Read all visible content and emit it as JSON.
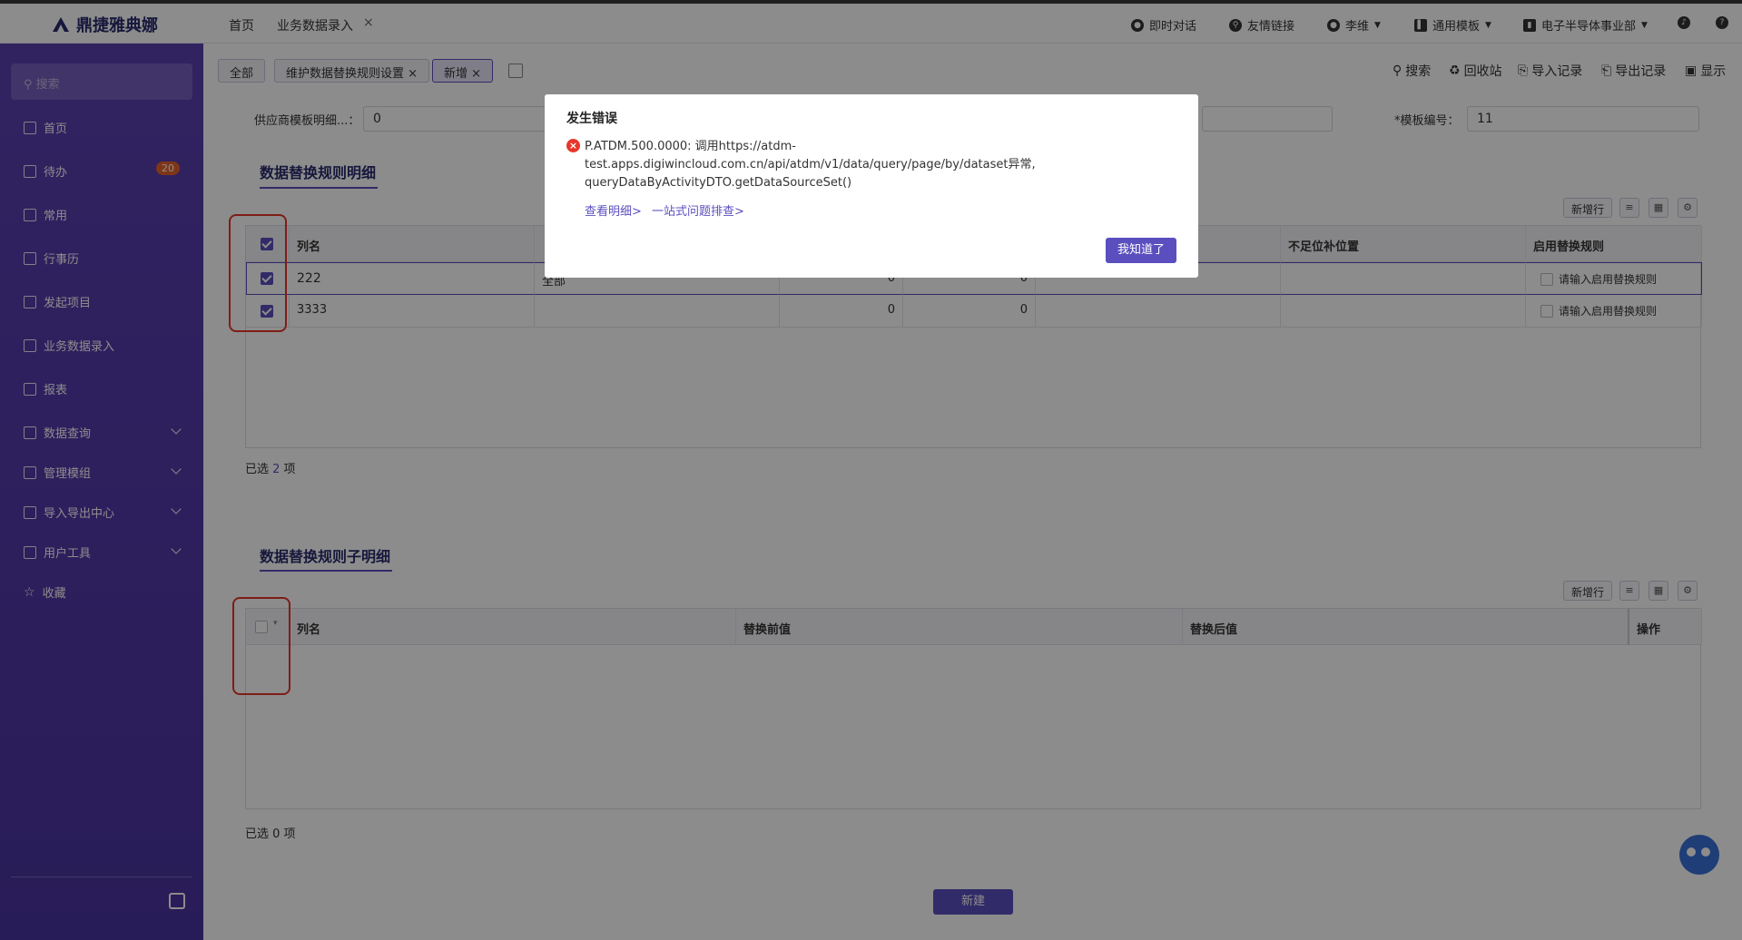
{
  "app": {
    "logo_text": "鼎捷雅典娜",
    "tabs": [
      {
        "label": "首页"
      },
      {
        "label": "业务数据录入",
        "close": "×"
      }
    ],
    "top_right": {
      "chat": "即时对话",
      "links": "友情链接",
      "user": "李维",
      "template": "通用模板",
      "dept": "电子半导体事业部"
    }
  },
  "sidebar": {
    "search_placeholder": "搜索",
    "items": [
      {
        "label": "首页",
        "icon": "home-icon"
      },
      {
        "label": "待办",
        "icon": "todo-icon",
        "badge": "20"
      },
      {
        "label": "常用",
        "icon": "pin-icon"
      },
      {
        "label": "行事历",
        "icon": "calendar-icon"
      },
      {
        "label": "发起项目",
        "icon": "project-icon"
      },
      {
        "label": "业务数据录入",
        "icon": "data-entry-icon"
      },
      {
        "label": "报表",
        "icon": "report-icon"
      },
      {
        "label": "数据查询",
        "icon": "query-icon",
        "expand": true
      },
      {
        "label": "管理模组",
        "icon": "module-icon",
        "expand": true
      },
      {
        "label": "导入导出中心",
        "icon": "import-export-icon",
        "expand": true
      },
      {
        "label": "用户工具",
        "icon": "tools-icon",
        "expand": true
      },
      {
        "label": "收藏",
        "icon": "star-icon"
      }
    ]
  },
  "main": {
    "chips": [
      {
        "label": "全部"
      },
      {
        "label": "维护数据替换规则设置",
        "close": "×"
      },
      {
        "label": "新增",
        "close": "×"
      }
    ],
    "toolbar": {
      "search": "搜索",
      "recycle": "回收站",
      "import_log": "导入记录",
      "export_log": "导出记录",
      "display": "显示"
    },
    "form": {
      "supplier_label": "供应商模板明细...：",
      "supplier_value": "0",
      "template_no_label": "*模板编号：",
      "template_no_value": "11"
    },
    "section1": {
      "title": "数据替换规则明细",
      "add_row": "新增行",
      "columns": [
        "列名",
        "不足位补位置",
        "启用替换规则"
      ],
      "rows": [
        {
          "col_name": "222",
          "c2": "全部",
          "c3": "0",
          "c4": "0",
          "rule": "请输入启用替换规则"
        },
        {
          "col_name": "3333",
          "c3": "0",
          "c4": "0",
          "rule": "请输入启用替换规则"
        }
      ],
      "selected_prefix": "已选 ",
      "selected_count": "2",
      "selected_suffix": " 项"
    },
    "section2": {
      "title": "数据替换规则子明细",
      "add_row": "新增行",
      "columns": [
        "列名",
        "替换前值",
        "替换后值",
        "操作"
      ],
      "selected": "已选 0 项"
    },
    "new_button": "新建"
  },
  "modal": {
    "title": "发生错误",
    "message_line1": "P.ATDM.500.0000: 调用https://atdm-",
    "message_line2": "test.apps.digiwincloud.com.cn/api/atdm/v1/data/query/page/by/dataset异常,",
    "message_line3": "queryDataByActivityDTO.getDataSourceSet()",
    "link_detail": "查看明细>",
    "link_troubleshoot": "一站式问题排查>",
    "ok_button": "我知道了"
  },
  "colors": {
    "accent": "#5b4fbf",
    "sidebar": "#5a3fb0",
    "error": "#e8362a"
  }
}
